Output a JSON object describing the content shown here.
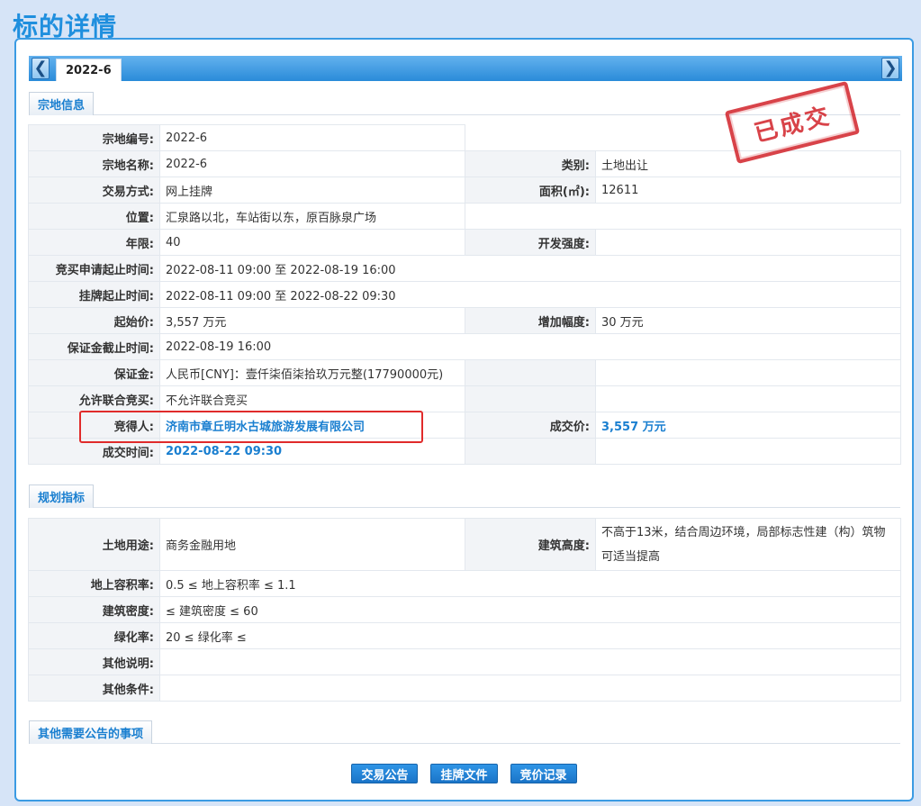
{
  "page": {
    "title": "标的详情"
  },
  "tabs": {
    "active": "2022-6"
  },
  "stamp": {
    "text": "已成交",
    "color": "#d2232a"
  },
  "sections": {
    "land_info": "宗地信息",
    "planning": "规划指标",
    "other_notices": "其他需要公告的事项"
  },
  "land": {
    "labels": {
      "parcel_no": "宗地编号:",
      "parcel_name": "宗地名称:",
      "category": "类别:",
      "trade_mode": "交易方式:",
      "area": "面积(㎡):",
      "location": "位置:",
      "term": "年限:",
      "dev_intensity": "开发强度:",
      "apply_period": "竞买申请起止时间:",
      "listing_period": "挂牌起止时间:",
      "start_price": "起始价:",
      "increment": "增加幅度:",
      "deposit_deadline": "保证金截止时间:",
      "deposit": "保证金:",
      "joint_bid": "允许联合竞买:",
      "winner": "竞得人:",
      "deal_price": "成交价:",
      "deal_time": "成交时间:"
    },
    "values": {
      "parcel_no": "2022-6",
      "parcel_name": "2022-6",
      "category": "土地出让",
      "trade_mode": "网上挂牌",
      "area": "12611",
      "location": "汇泉路以北，车站街以东，原百脉泉广场",
      "term": "40",
      "dev_intensity": "",
      "apply_period": "2022-08-11 09:00 至 2022-08-19 16:00",
      "listing_period": "2022-08-11 09:00 至 2022-08-22 09:30",
      "start_price": "3,557 万元",
      "increment": "30 万元",
      "deposit_deadline": "2022-08-19 16:00",
      "deposit": "人民币[CNY]：壹仟柒佰柒拾玖万元整(17790000元)",
      "joint_bid": "不允许联合竞买",
      "winner": "济南市章丘明水古城旅游发展有限公司",
      "deal_price": "3,557 万元",
      "deal_time": "2022-08-22 09:30"
    }
  },
  "planning": {
    "labels": {
      "land_use": "土地用途:",
      "building_height": "建筑高度:",
      "far": "地上容积率:",
      "density": "建筑密度:",
      "green": "绿化率:",
      "other_notes": "其他说明:",
      "other_conditions": "其他条件:"
    },
    "values": {
      "land_use": "商务金融用地",
      "building_height": "不高于13米，结合周边环境，局部标志性建（构）筑物可适当提高",
      "far": "0.5 ≤ 地上容积率 ≤ 1.1",
      "density": "≤ 建筑密度 ≤ 60",
      "green": "20 ≤ 绿化率 ≤",
      "other_notes": "",
      "other_conditions": ""
    }
  },
  "buttons": {
    "notice": "交易公告",
    "listing_doc": "挂牌文件",
    "bid_record": "竞价记录"
  },
  "nav": {
    "prev": "❮",
    "next": "❯"
  }
}
